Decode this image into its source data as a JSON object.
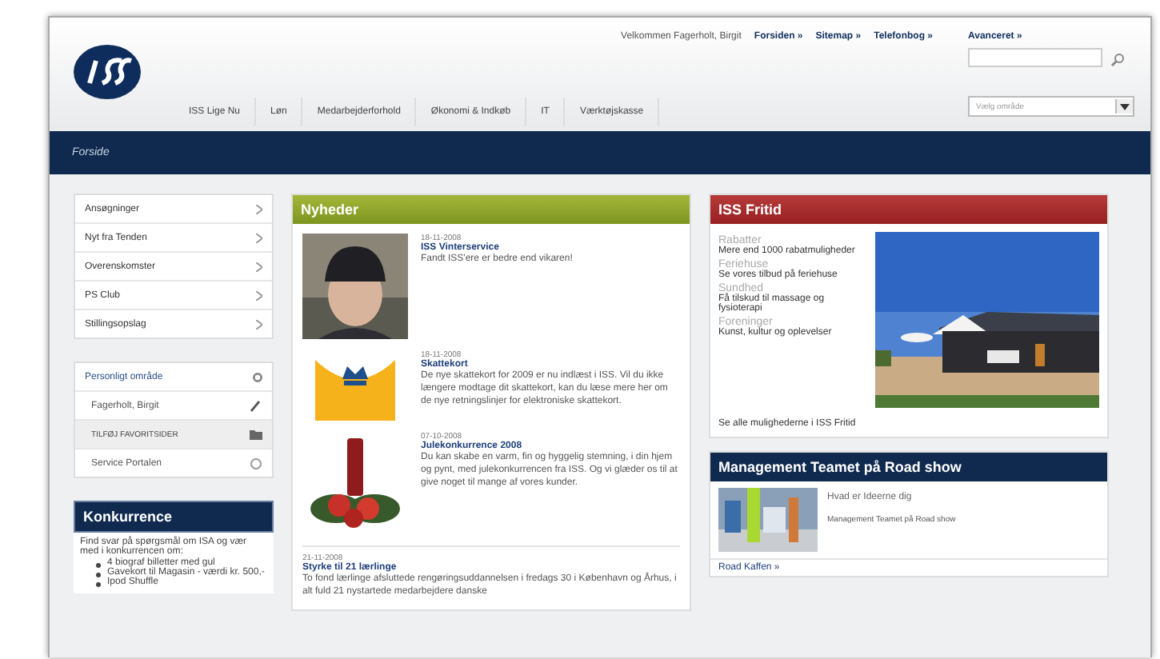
{
  "header": {
    "greeting": "Velkommen Fagerholt, Birgit",
    "top_links": [
      "Forsiden »",
      "Sitemap »",
      "Telefonbog »"
    ],
    "advanced_link": "Avanceret »",
    "area_select": {
      "value": "Vælg område"
    }
  },
  "nav": [
    "ISS Lige Nu",
    "Løn",
    "Medarbejderforhold",
    "Økonomi & Indkøb",
    "IT",
    "Værktøjskasse"
  ],
  "breadcrumb": "Forside",
  "left_menu": [
    "Ansøgninger",
    "Nyt fra Tenden",
    "Overenskomster",
    "PS Club",
    "Stillingsopslag"
  ],
  "personal": {
    "title": "Personligt område",
    "items": [
      {
        "label": "Fagerholt, Birgit",
        "kind": "user"
      },
      {
        "label": "TILFØJ FAVORITSIDER",
        "kind": "add"
      },
      {
        "label": "Service Portalen",
        "kind": "portal"
      }
    ]
  },
  "competition": {
    "title": "Konkurrence",
    "text": "Find svar på spørgsmål om ISA og vær med i konkurrencen om:",
    "bullets": [
      "4 biograf billetter med gul",
      "Gavekort til Magasin - værdi kr. 500,-",
      "Ipod Shuffle"
    ]
  },
  "news": {
    "title": "Nyheder",
    "items": [
      {
        "date": "18-11-2008",
        "title": "ISS Vinterservice",
        "text": "Fandt ISS'ere er bedre end vikaren!"
      },
      {
        "date": "18-11-2008",
        "title": "Skattekort",
        "text": "De nye skattekort for 2009 er nu indlæst i ISS. Vil du ikke længere modtage dit skattekort, kan du læse mere her om de nye retningslinjer for elektroniske skattekort.",
        "kind": "logo"
      },
      {
        "date": "07-10-2008",
        "title": "Julekonkurrence 2008",
        "text": "Du kan skabe en varm, fin og hyggelig stemning, i din hjem og pynt, med julekonkurrencen fra ISS. Og vi glæder os til at give noget til mange af vores kunder.",
        "kind": "photo_candle"
      },
      {
        "date": "21-11-2008",
        "title": "Styrke til 21 lærlinge",
        "text": "To fond lærlinge afsluttede rengøringsuddannelsen i fredags 30 i København og Århus, i alt fuld 21 nystartede medarbejdere danske",
        "kind": "text"
      }
    ]
  },
  "fritid": {
    "title": "ISS Fritid",
    "sections": [
      {
        "heading": "Rabatter",
        "text": "Mere end 1000 rabatmuligheder"
      },
      {
        "heading": "Feriehuse",
        "text": "Se vores tilbud på feriehuse"
      },
      {
        "heading": "Sundhed",
        "text": "Få tilskud til massage og fysioterapi"
      },
      {
        "heading": "Foreninger",
        "text": "Kunst, kultur og oplevelser"
      }
    ],
    "footer": "Se alle mulighederne i ISS Fritid"
  },
  "management": {
    "title": "Management Teamet på Road show",
    "subtitle": "Hvad er Ideerne dig",
    "text": "Management Teamet på Road show",
    "more": "Road Kaffen »"
  }
}
